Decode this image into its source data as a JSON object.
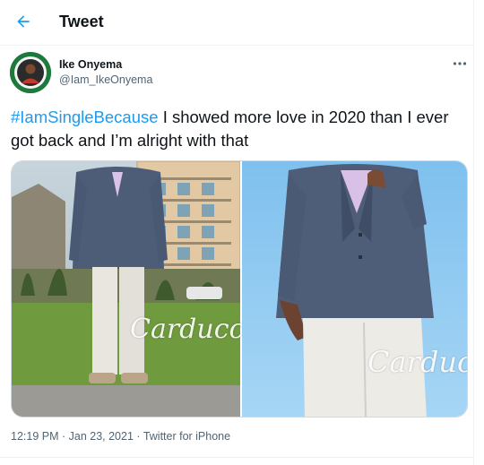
{
  "header": {
    "title": "Tweet"
  },
  "author": {
    "name": "Ike Onyema",
    "handle": "@Iam_IkeOnyema"
  },
  "tweet": {
    "hashtag": "#IamSingleBecause",
    "text": " I showed more love in 2020 than I ever got back and I’m alright with that"
  },
  "media": {
    "watermark_left": "Carducci",
    "watermark_right": "Carducci"
  },
  "meta": {
    "time": "12:19 PM",
    "separator1": " · ",
    "date": "Jan 23, 2021",
    "separator2": " · ",
    "source": "Twitter for iPhone"
  },
  "icons": {
    "back": "arrow-left-icon",
    "more": "more-horizontal-icon"
  },
  "colors": {
    "accent": "#1d9bf0",
    "text": "#0f1419",
    "secondary": "#536471"
  }
}
